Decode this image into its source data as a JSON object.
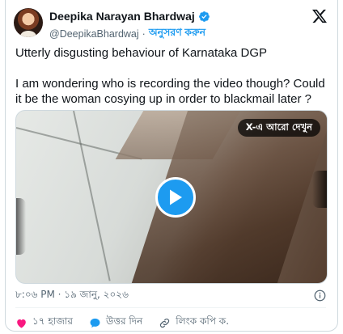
{
  "post": {
    "author_name": "Deepika Narayan Bhardwaj",
    "handle": "@DeepikaBhardwaj",
    "separator": "·",
    "follow_label": "অনুসরণ করুন",
    "text_line1": "Utterly disgusting behaviour of Karnataka DGP",
    "text_line2": "I am wondering who is recording the video though? Could it be the woman cosying up in order to blackmail later ?",
    "video_badge": "X-এ আরো দেখুন",
    "timestamp": "৮:০৬ PM · ১৯ জানু, ২০২৬"
  },
  "actions": {
    "like_count": "১৭ হাজার",
    "reply_label": "উত্তর দিন",
    "copy_link_label": "লিংক কপি ক."
  },
  "colors": {
    "accent": "#1d9bf0",
    "like": "#f91880",
    "text": "#0f1419",
    "muted": "#536471"
  },
  "icons": [
    "verified-badge-icon",
    "x-logo-icon",
    "play-icon",
    "info-icon",
    "heart-icon",
    "reply-bubble-icon",
    "link-icon"
  ]
}
